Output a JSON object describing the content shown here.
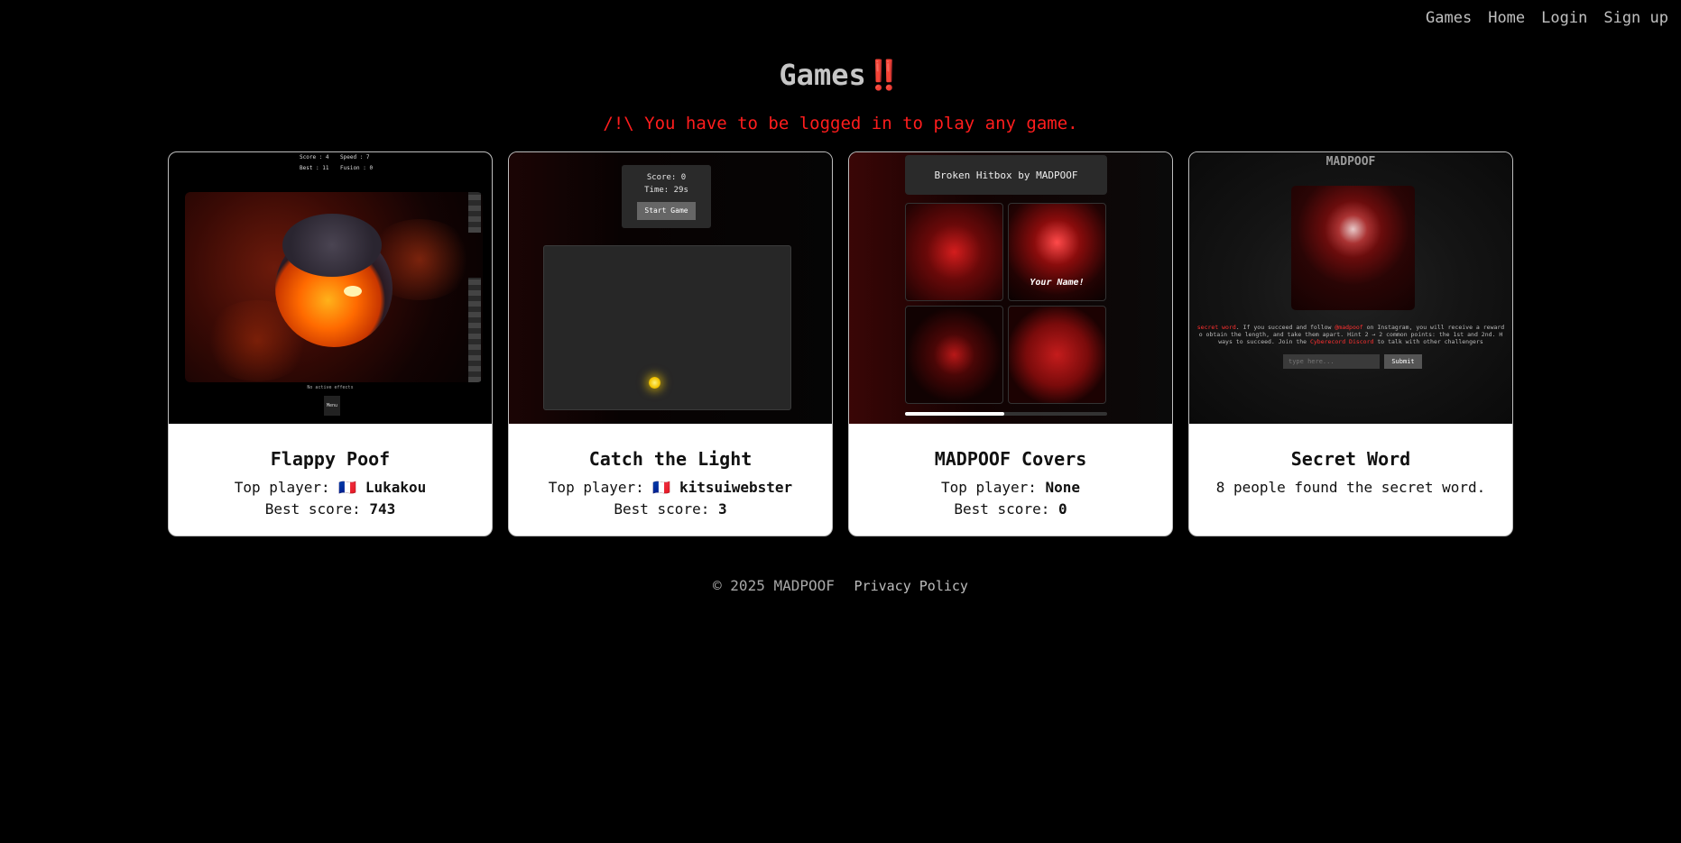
{
  "nav": {
    "items": [
      {
        "label": "Games"
      },
      {
        "label": "Home"
      },
      {
        "label": "Login"
      },
      {
        "label": "Sign up"
      }
    ]
  },
  "header": {
    "title": "Games",
    "title_icon": "‼️",
    "warning": "/!\\ You have to be logged in to play any game."
  },
  "cards": [
    {
      "title": "Flappy Poof",
      "top_label": "Top player: ",
      "flag": "🇫🇷",
      "top_player": "Lukakou",
      "score_label": "Best score: ",
      "best_score": "743",
      "preview": {
        "hud": [
          "Score : 4",
          "Speed : 7",
          "Best : 11",
          "Fusion : 0"
        ],
        "caption": "No active effects",
        "button": "Menu"
      }
    },
    {
      "title": "Catch the Light",
      "top_label": "Top player: ",
      "flag": "🇫🇷",
      "top_player": "kitsuiwebster",
      "score_label": "Best score: ",
      "best_score": "3",
      "preview": {
        "score": "Score: 0",
        "time": "Time: 29s",
        "button": "Start Game"
      }
    },
    {
      "title": "MADPOOF Covers",
      "top_label": "Top player: ",
      "top_player": "None",
      "score_label": "Best score: ",
      "best_score": "0",
      "preview": {
        "header": "Broken Hitbox by MADPOOF",
        "tile_text": "Your Name!",
        "progress": 0.49
      }
    },
    {
      "title": "Secret Word",
      "description": "8 people found the secret word.",
      "preview": {
        "header": "MADPOOF",
        "text_line1_red": "secret word",
        "text_line1": ". If you succeed and follow ",
        "text_line1_link": "@madpoof",
        "text_line1_end": " on Instagram, you will receive a reward",
        "text_line2": "o obtain the length, and take them apart. Hint 2 → 2 common points: the 1st and 2nd. H",
        "text_line3_start": "ways to succeed. Join the ",
        "text_line3_red": "Cyberecord Discord",
        "text_line3_end": " to talk with other challengers",
        "input_placeholder": "type here...",
        "submit": "Submit"
      }
    }
  ],
  "footer": {
    "copyright": "© 2025 MADPOOF",
    "privacy": "Privacy Policy"
  }
}
